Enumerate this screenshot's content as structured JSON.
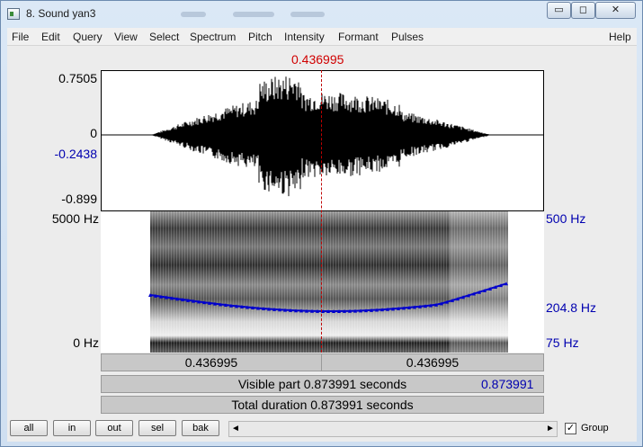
{
  "window": {
    "title": "8. Sound yan3",
    "minimize_label": "▭",
    "maximize_label": "◻",
    "close_label": "✕"
  },
  "menu": {
    "items": [
      "File",
      "Edit",
      "Query",
      "View",
      "Select",
      "Spectrum",
      "Pitch",
      "Intensity",
      "Formant",
      "Pulses"
    ],
    "help": "Help"
  },
  "cursor": {
    "time_label": "0.436995",
    "time": 0.436995
  },
  "waveform": {
    "max_label": "0.7505",
    "zero_label": "0",
    "cursor_value_label": "-0.2438",
    "min_label": "-0.899"
  },
  "spectrogram": {
    "top_freq_label": "5000 Hz",
    "bottom_freq_label": "0 Hz",
    "pitch_top_label": "500 Hz",
    "pitch_cursor_label": "204.8 Hz",
    "pitch_bottom_label": "75 Hz",
    "pitch_color": "#0000cc"
  },
  "selection": {
    "left_label": "0.436995",
    "right_label": "0.436995",
    "visible_start": "0",
    "visible_part_label": "Visible part 0.873991 seconds",
    "visible_end": "0.873991",
    "total_label": "Total duration 0.873991 seconds"
  },
  "buttons": {
    "all": "all",
    "in": "in",
    "out": "out",
    "sel": "sel",
    "bak": "bak"
  },
  "group": {
    "label": "Group",
    "checked": true,
    "check_glyph": "✓"
  },
  "scrollbar": {
    "left": "◄",
    "right": "►"
  }
}
